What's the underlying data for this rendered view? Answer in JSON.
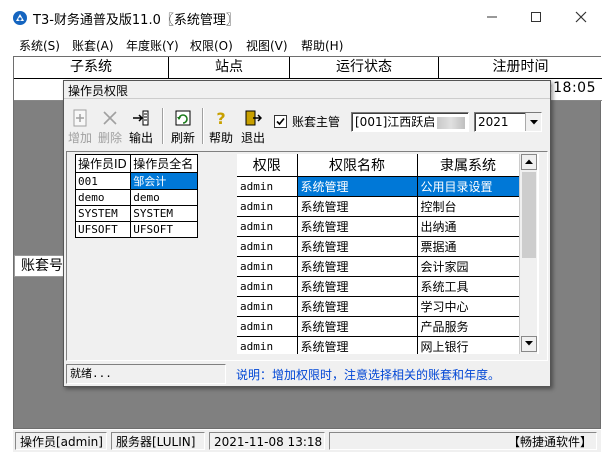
{
  "window": {
    "title": "T3-财务通普及版11.0〖系统管理〗",
    "controls": [
      "minimize",
      "maximize",
      "close"
    ]
  },
  "menu": [
    "系统(S)",
    "账套(A)",
    "年度账(Y)",
    "权限(O)",
    "视图(V)",
    "帮助(H)"
  ],
  "main_header": [
    "子系统",
    "站点",
    "运行状态",
    "注册时间"
  ],
  "main_time_fragment": ":18:05",
  "lower_panel_label": "账套号",
  "statusbar": {
    "operator": "操作员[admin]",
    "server": "服务器[LULIN]",
    "datetime": "2021-11-08 13:18",
    "brand": "【畅捷通软件】"
  },
  "dialog": {
    "title": "操作员权限",
    "toolbar": {
      "add": "增加",
      "delete": "删除",
      "export": "输出",
      "refresh": "刷新",
      "help": "帮助",
      "exit": "退出"
    },
    "account_master_label": "账套主管",
    "account_master_checked": true,
    "account_combo": "[001]江西跃启",
    "year_combo": "2021",
    "operator_table": {
      "headers": [
        "操作员ID",
        "操作员全名"
      ],
      "rows": [
        [
          "001",
          "邹会计"
        ],
        [
          "demo",
          "demo"
        ],
        [
          "SYSTEM",
          "SYSTEM"
        ],
        [
          "UFSOFT",
          "UFSOFT"
        ]
      ],
      "selected_index": 0
    },
    "permission_table": {
      "headers": [
        "权限",
        "权限名称",
        "隶属系统"
      ],
      "rows": [
        [
          "admin",
          "系统管理",
          "公用目录设置"
        ],
        [
          "admin",
          "系统管理",
          "控制台"
        ],
        [
          "admin",
          "系统管理",
          "出纳通"
        ],
        [
          "admin",
          "系统管理",
          "票据通"
        ],
        [
          "admin",
          "系统管理",
          "会计家园"
        ],
        [
          "admin",
          "系统管理",
          "系统工具"
        ],
        [
          "admin",
          "系统管理",
          "学习中心"
        ],
        [
          "admin",
          "系统管理",
          "产品服务"
        ],
        [
          "admin",
          "系统管理",
          "网上银行"
        ]
      ],
      "selected_index": 0
    },
    "status_left": "就绪...",
    "status_note": "说明：增加权限时，注意选择相关的账套和年度。"
  },
  "colors": {
    "selection": "#0078d7",
    "note_text": "#0046d5",
    "mdi_background": "#808080"
  }
}
